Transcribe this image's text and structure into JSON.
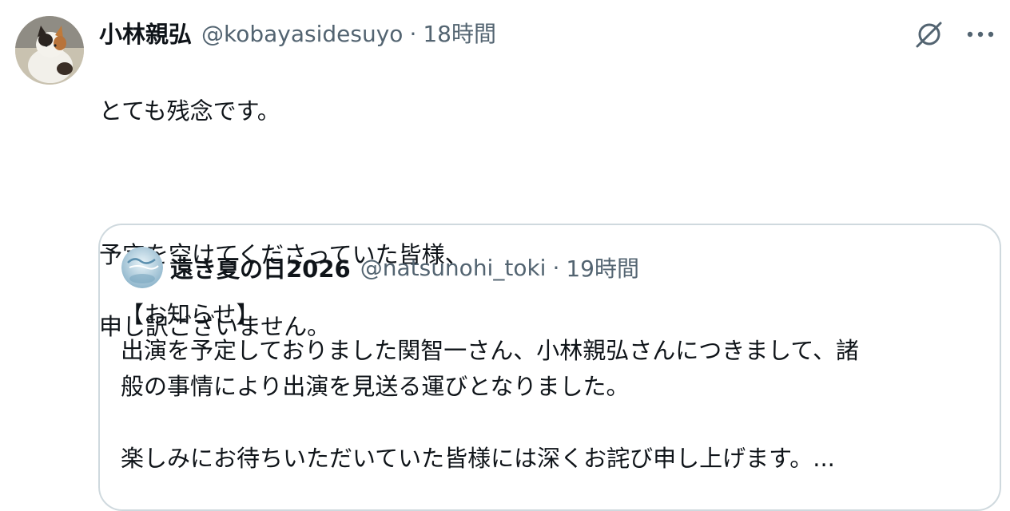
{
  "tweet": {
    "author": {
      "display_name": "小林親弘",
      "handle": "@kobayasidesuyo",
      "avatar": "cat-photo-avatar"
    },
    "separator": "·",
    "time": "18時間",
    "text_lines": [
      "とても残念です。",
      "予定を空けてくださっていた皆様、",
      "申し訳ございません。"
    ],
    "icons": [
      "grok-icon",
      "more-options-icon"
    ]
  },
  "quote": {
    "author": {
      "display_name": "遠き夏の日2026",
      "handle": "@natsunohi_toki",
      "avatar": "event-logo-avatar"
    },
    "separator": "·",
    "time": "19時間",
    "lines": [
      "【お知らせ】",
      "出演を予定しておりました関智一さん、小林親弘さんにつきまして、諸",
      "般の事情により出演を見送る運びとなりました。",
      "楽しみにお待ちいただいていた皆様には深くお詫び申し上げます。..."
    ]
  },
  "colors": {
    "text": "#0f1419",
    "secondary": "#536471",
    "border": "#cfd9de"
  }
}
